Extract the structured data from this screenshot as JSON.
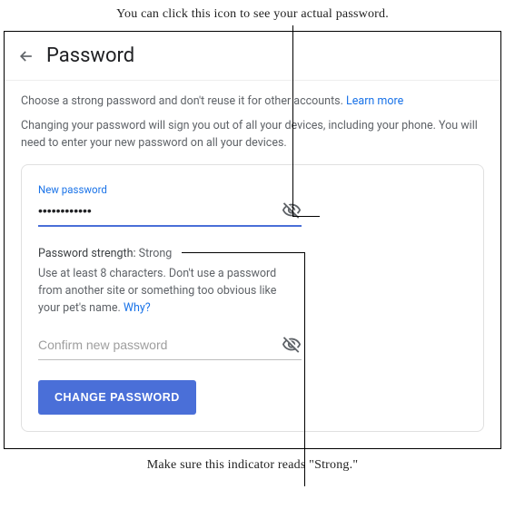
{
  "annotations": {
    "top": "You can click this icon to see your actual password.",
    "bottom": "Make sure this indicator reads \"Strong.\""
  },
  "header": {
    "title": "Password"
  },
  "instructions": {
    "line1": "Choose a strong password and don't reuse it for other accounts. ",
    "learn_more": "Learn more",
    "line2": "Changing your password will sign you out of all your devices, including your phone. You will need to enter your new password on all your devices."
  },
  "form": {
    "new_password_label": "New password",
    "new_password_value": "••••••••••••",
    "strength_prefix": "Password strength: ",
    "strength_value": "Strong",
    "guidance": "Use at least 8 characters. Don't use a password from another site or something too obvious like your pet's name. ",
    "why_link": "Why?",
    "confirm_placeholder": "Confirm new password",
    "change_button": "CHANGE PASSWORD"
  }
}
